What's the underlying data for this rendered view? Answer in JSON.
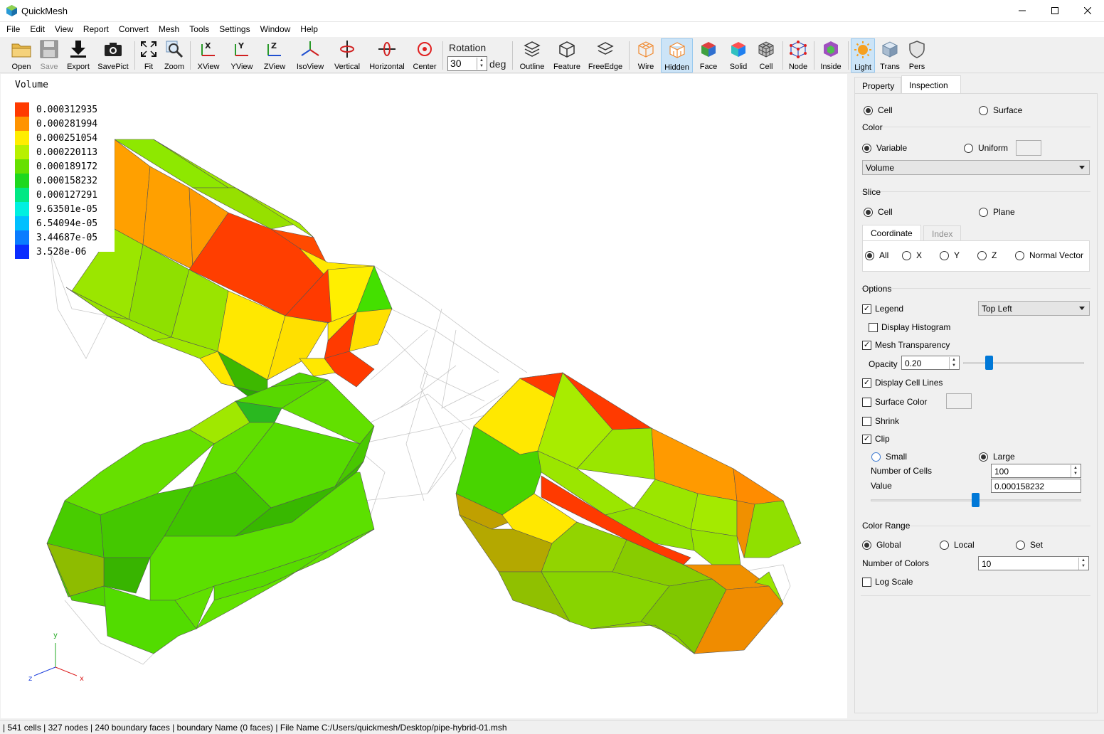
{
  "window": {
    "title": "QuickMesh",
    "minimize_icon": "minimize-icon",
    "maximize_icon": "maximize-icon",
    "close_icon": "close-icon"
  },
  "menu": [
    "File",
    "Edit",
    "View",
    "Report",
    "Convert",
    "Mesh",
    "Tools",
    "Settings",
    "Window",
    "Help"
  ],
  "toolbar": {
    "open": "Open",
    "save": "Save",
    "export": "Export",
    "savepict": "SavePict",
    "fit": "Fit",
    "zoom": "Zoom",
    "xview": "XView",
    "yview": "YView",
    "zview": "ZView",
    "isoview": "IsoView",
    "vertical": "Vertical",
    "horizontal": "Horizontal",
    "center": "Center",
    "rotation_label": "Rotation",
    "rotation_value": "30",
    "rotation_unit": "deg",
    "outline": "Outline",
    "feature": "Feature",
    "freeedge": "FreeEdge",
    "wire": "Wire",
    "hidden": "Hidden",
    "face": "Face",
    "solid": "Solid",
    "cell": "Cell",
    "node": "Node",
    "inside": "Inside",
    "light": "Light",
    "trans": "Trans",
    "pers": "Pers"
  },
  "legend": {
    "title": "Volume",
    "entries": [
      {
        "value": "0.000312935",
        "color": "#ff3a00"
      },
      {
        "value": "0.000281994",
        "color": "#ff9400"
      },
      {
        "value": "0.000251054",
        "color": "#ffed00"
      },
      {
        "value": "0.000220113",
        "color": "#b8f000"
      },
      {
        "value": "0.000189172",
        "color": "#66e000"
      },
      {
        "value": "0.000158232",
        "color": "#1ed81e"
      },
      {
        "value": "0.000127291",
        "color": "#00e884"
      },
      {
        "value": "9.63501e-05",
        "color": "#00f0e0"
      },
      {
        "value": "6.54094e-05",
        "color": "#00c0ff"
      },
      {
        "value": "3.44687e-05",
        "color": "#0a7cff"
      },
      {
        "value": "3.528e-06",
        "color": "#0a2cff"
      }
    ]
  },
  "axes": {
    "y": "y",
    "x": "x",
    "z": "z"
  },
  "panel": {
    "tabs": [
      "Property",
      "Inspection"
    ],
    "active_tab": "Inspection",
    "mode": {
      "cell": "Cell",
      "surface": "Surface"
    },
    "color": {
      "title": "Color",
      "variable": "Variable",
      "uniform": "Uniform",
      "variable_select": "Volume"
    },
    "slice": {
      "title": "Slice",
      "cell": "Cell",
      "plane": "Plane",
      "tabs": [
        "Coordinate",
        "Index"
      ],
      "all": "All",
      "x": "X",
      "y": "Y",
      "z": "Z",
      "normal": "Normal Vector"
    },
    "options": {
      "title": "Options",
      "legend": "Legend",
      "legend_position": "Top Left",
      "display_histogram": "Display Histogram",
      "mesh_transparency": "Mesh Transparency",
      "opacity_label": "Opacity",
      "opacity_value": "0.20",
      "display_cell_lines": "Display Cell Lines",
      "surface_color": "Surface Color",
      "shrink": "Shrink",
      "clip": "Clip",
      "small": "Small",
      "large": "Large",
      "num_cells_label": "Number of Cells",
      "num_cells_value": "100",
      "value_label": "Value",
      "value_value": "0.000158232"
    },
    "color_range": {
      "title": "Color Range",
      "global": "Global",
      "local": "Local",
      "set": "Set",
      "num_colors_label": "Number of Colors",
      "num_colors_value": "10",
      "log_scale": "Log Scale"
    }
  },
  "status": "| 541 cells | 327 nodes | 240 boundary faces |  boundary Name  (0 faces) | File Name C:/Users/quickmesh/Desktop/pipe-hybrid-01.msh"
}
